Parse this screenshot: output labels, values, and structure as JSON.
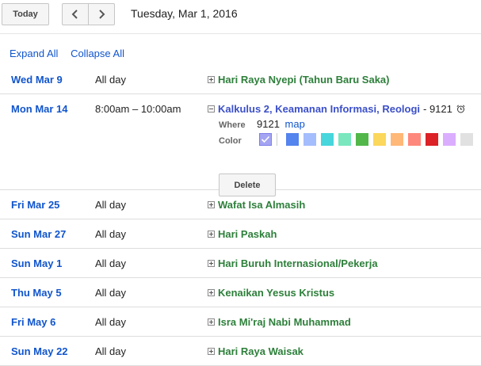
{
  "toolbar": {
    "today_label": "Today",
    "prev_icon": "chevron-left-icon",
    "next_icon": "chevron-right-icon",
    "date_title": "Tuesday, Mar 1, 2016"
  },
  "controls": {
    "expand_all": "Expand All",
    "collapse_all": "Collapse All"
  },
  "events": [
    {
      "date": "Wed Mar 9",
      "time": "All day",
      "title": "Hari Raya Nyepi (Tahun Baru Saka)",
      "expanded": false
    },
    {
      "date": "Mon Mar 14",
      "time": "8:00am – 10:00am",
      "title": "Kalkulus 2, Keamanan Informasi, Reologi",
      "title_suffix": "- 9121",
      "has_alarm": true,
      "expanded": true,
      "details": {
        "where_label": "Where",
        "where_value": "9121",
        "map_link": "map",
        "color_label": "Color",
        "delete_label": "Delete"
      }
    },
    {
      "date": "Fri Mar 25",
      "time": "All day",
      "title": "Wafat Isa Almasih",
      "expanded": false
    },
    {
      "date": "Sun Mar 27",
      "time": "All day",
      "title": "Hari Paskah",
      "expanded": false
    },
    {
      "date": "Sun May 1",
      "time": "All day",
      "title": "Hari Buruh Internasional/Pekerja",
      "expanded": false
    },
    {
      "date": "Thu May 5",
      "time": "All day",
      "title": "Kenaikan Yesus Kristus",
      "expanded": false
    },
    {
      "date": "Fri May 6",
      "time": "All day",
      "title": "Isra Mi'raj Nabi Muhammad",
      "expanded": false
    },
    {
      "date": "Sun May 22",
      "time": "All day",
      "title": "Hari Raya Waisak",
      "expanded": false
    }
  ],
  "colors": {
    "allday_event_title": "#2d7f3a",
    "timed_event_title": "#3b4fc8",
    "link": "#1155cc",
    "selected_swatch": "#a4a4f3",
    "swatches": [
      "#5484ed",
      "#a4bdfc",
      "#46d6db",
      "#7ae7bf",
      "#51b749",
      "#fbd75b",
      "#ffb878",
      "#ff887c",
      "#dc2127",
      "#dbadff",
      "#e1e1e1"
    ]
  }
}
